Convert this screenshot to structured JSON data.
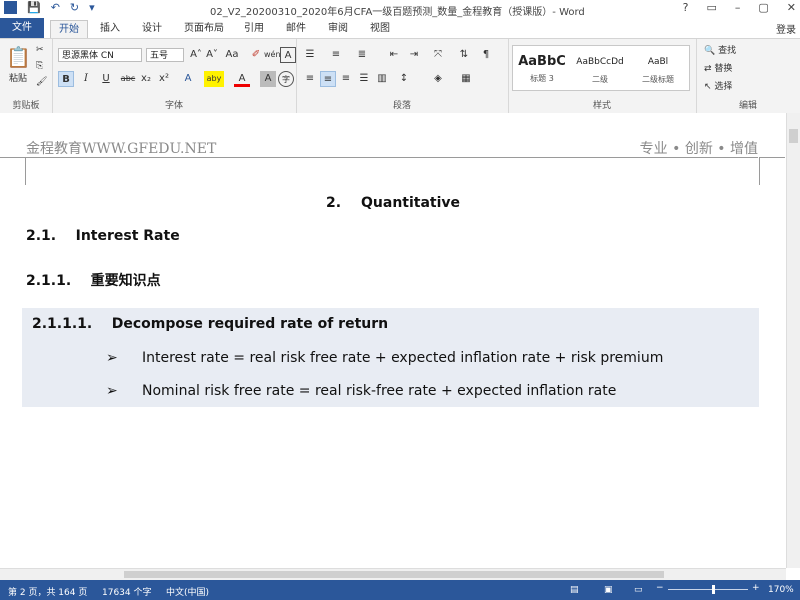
{
  "window": {
    "title": "02_V2_20200310_2020年6月CFA一级百题预测_数量_金程教育（授课版）- Word",
    "controls": [
      "?",
      "▭",
      "–",
      "▢",
      "✕"
    ],
    "login": "登录"
  },
  "qat": {
    "word_logo": "W",
    "save": "💾",
    "undo": "↶",
    "redo": "↻",
    "more": "▾"
  },
  "tabs": [
    "文件",
    "开始",
    "插入",
    "设计",
    "页面布局",
    "引用",
    "邮件",
    "审阅",
    "视图"
  ],
  "ribbon": {
    "clipboard": {
      "paste": "粘贴",
      "label": "剪贴板"
    },
    "font": {
      "font_name": "思源黑体 CN",
      "font_size": "五号",
      "grow": "A˄",
      "shrink": "A˅",
      "case": "Aa",
      "clear": "✐",
      "phonetic": "wén",
      "border": "A",
      "bold": "B",
      "italic": "I",
      "underline": "U",
      "strike": "abc",
      "sub": "x₂",
      "sup": "x²",
      "effects": "A",
      "highlight": "aby",
      "color": "A",
      "shading": "A",
      "enclose": "字",
      "label": "字体"
    },
    "paragraph": {
      "label": "段落"
    },
    "styles": {
      "label": "样式",
      "items": [
        {
          "sample": "AaBbC",
          "name": "标题 3"
        },
        {
          "sample": "AaBbCcDd",
          "name": "二级"
        },
        {
          "sample": "AaBl",
          "name": "二级标题"
        }
      ]
    },
    "editing": {
      "find": "查找",
      "replace": "替换",
      "select": "选择",
      "label": "编辑"
    }
  },
  "document": {
    "header_left": "金程教育WWW.GFEDU.NET",
    "header_right": "专业 • 创新 • 增值",
    "h1_num": "2.",
    "h1_text": "Quantitative",
    "h2": "2.1.    Interest Rate",
    "h3": "2.1.1.    重要知识点",
    "h4": "2.1.1.1.    Decompose required rate of return",
    "bullet_marker": "➢",
    "bullets": [
      "Interest rate = real risk free rate + expected inflation rate + risk premium",
      "Nominal risk free rate = real risk-free rate + expected inflation rate"
    ]
  },
  "status": {
    "page": "第 2 页，共 164 页",
    "words": "17634 个字",
    "language": "中文(中国)",
    "zoom": "170%"
  }
}
